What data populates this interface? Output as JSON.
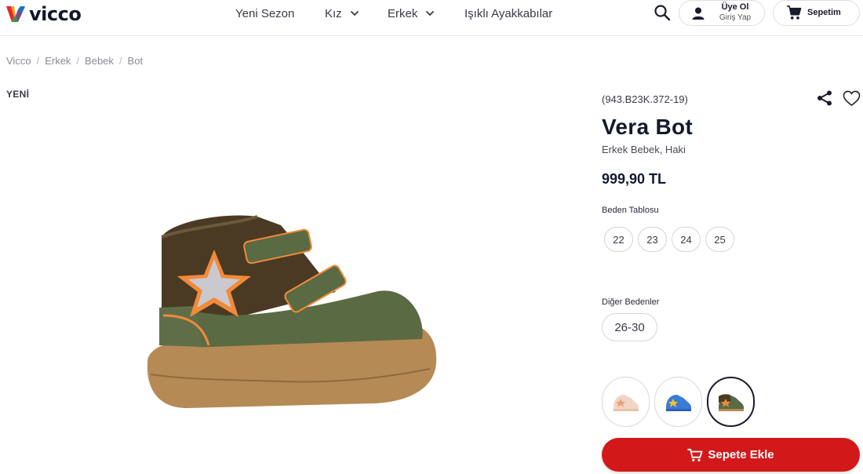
{
  "header": {
    "logo_text": "vicco",
    "nav": [
      {
        "label": "Yeni Sezon"
      },
      {
        "label": "Kız"
      },
      {
        "label": "Erkek"
      },
      {
        "label": "Işıklı Ayakkabılar"
      }
    ],
    "user": {
      "line1": "Üye Ol",
      "line2": "Giriş Yap"
    },
    "cart": {
      "label": "Sepetim"
    }
  },
  "breadcrumb": [
    "Vicco",
    "Erkek",
    "Bebek",
    "Bot"
  ],
  "badge": "YENİ",
  "product": {
    "sku": "(943.B23K.372-19)",
    "title": "Vera Bot",
    "subtitle": "Erkek Bebek, Haki",
    "price": "999,90 TL",
    "size_label": "Beden Tablosu",
    "sizes": [
      "22",
      "23",
      "24",
      "25"
    ],
    "other_label": "Diğer Bedenler",
    "other_size": "26-30",
    "add_to_cart": "Sepete Ekle"
  },
  "colors": {
    "accent": "#d3181a",
    "text_dark": "#131a2e",
    "swatches": [
      "#f1d6c8",
      "#3b7ad6",
      "#5a6a43"
    ]
  }
}
